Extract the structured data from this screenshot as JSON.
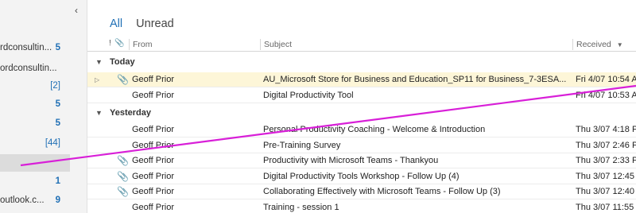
{
  "folders": [
    {
      "name": "rdconsultin...",
      "count": "5",
      "bold": true
    },
    {
      "name": "ordconsultin...",
      "count": "",
      "bold": false
    },
    {
      "name": "",
      "count": "[2]",
      "bold": false
    },
    {
      "name": "",
      "count": "5",
      "bold": true
    },
    {
      "name": "",
      "count": "5",
      "bold": true
    },
    {
      "name": "",
      "count": "[44]",
      "bold": false
    },
    {
      "name": "",
      "count": "",
      "bold": false,
      "selected": true
    },
    {
      "name": "",
      "count": "1",
      "bold": true
    },
    {
      "name": "outlook.c...",
      "count": "9",
      "bold": true
    }
  ],
  "tabs": [
    {
      "label": "All",
      "active": true
    },
    {
      "label": "Unread",
      "active": false
    }
  ],
  "columns": {
    "importance_icon": "!",
    "attachment_icon": "📎",
    "from": "From",
    "subject": "Subject",
    "received": "Received",
    "sort_icon": "▼"
  },
  "groups": {
    "today": "Today",
    "yesterday": "Yesterday"
  },
  "messages_today": [
    {
      "from": "Geoff Prior",
      "subject": "AU_Microsoft Store for Business and Education_SP11 for Business_7-3ESA...",
      "received": "Fri 4/07 10:54 A",
      "attachment": true,
      "highlight": true
    },
    {
      "from": "Geoff Prior",
      "subject": "Digital Productivity Tool",
      "received": "Fri 4/07 10:53 A",
      "attachment": false,
      "highlight": false
    }
  ],
  "messages_yesterday": [
    {
      "from": "Geoff Prior",
      "subject": "Personal Productivity Coaching - Welcome & Introduction",
      "received": "Thu 3/07 4:18 P",
      "attachment": false
    },
    {
      "from": "Geoff Prior",
      "subject": "Pre-Training Survey",
      "received": "Thu 3/07 2:46 P",
      "attachment": false
    },
    {
      "from": "Geoff Prior",
      "subject": "Productivity with Microsoft Teams - Thankyou",
      "received": "Thu 3/07 2:33 P",
      "attachment": true
    },
    {
      "from": "Geoff Prior",
      "subject": "Digital Productivity Tools Workshop - Follow Up (4)",
      "received": "Thu 3/07 12:45",
      "attachment": true
    },
    {
      "from": "Geoff Prior",
      "subject": "Collaborating Effectively with Microsoft Teams - Follow Up (3)",
      "received": "Thu 3/07 12:40",
      "attachment": true
    },
    {
      "from": "Geoff Prior",
      "subject": "Training - session 1",
      "received": "Thu 3/07 11:55",
      "attachment": false
    }
  ],
  "colors": {
    "accent": "#1f6fb5",
    "annotation_line": "#d81fd8",
    "highlight_row": "#fdf6d8"
  }
}
